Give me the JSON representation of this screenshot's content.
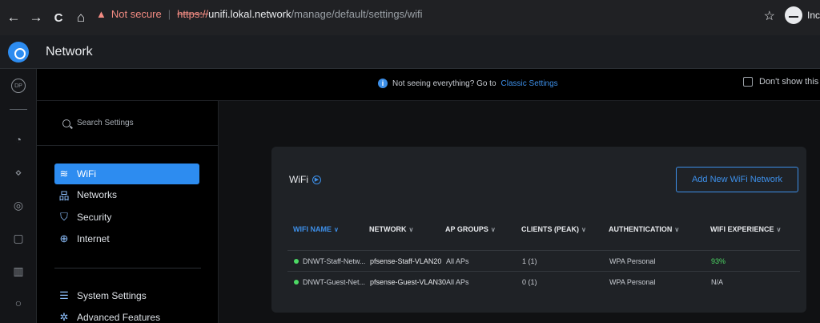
{
  "browser": {
    "back_glyph": "←",
    "forward_glyph": "→",
    "reload_glyph": "C",
    "home_glyph": "⌂",
    "warning_glyph": "▲",
    "not_secure": "Not secure",
    "separator": "|",
    "url_scheme": "https://",
    "url_host": "unifi.lokal.network",
    "url_path": "/manage/default/settings/wifi",
    "star_glyph": "☆",
    "incognito_label": "Incognito"
  },
  "header": {
    "title": "Network"
  },
  "rail": {
    "items": [
      {
        "icon": "dashboard-icon",
        "glyph": "DP"
      },
      {
        "icon": "statistics-icon",
        "glyph": "◔"
      },
      {
        "icon": "topology-icon",
        "glyph": "⋄"
      },
      {
        "icon": "devices-icon",
        "glyph": "◎"
      },
      {
        "icon": "clients-icon",
        "glyph": "▢"
      },
      {
        "icon": "insights-icon",
        "glyph": "▥"
      },
      {
        "icon": "alerts-icon",
        "glyph": "○"
      }
    ]
  },
  "banner": {
    "info_glyph": "i",
    "text": "Not seeing everything? Go to",
    "link": "Classic Settings",
    "dont_show": "Don't show this again"
  },
  "settings_nav": {
    "search_placeholder": "Search Settings",
    "items": [
      {
        "label": "WiFi",
        "icon": "wifi-icon",
        "glyph": "≋",
        "active": true
      },
      {
        "label": "Networks",
        "icon": "networks-icon",
        "glyph": "品",
        "active": false
      },
      {
        "label": "Security",
        "icon": "security-icon",
        "glyph": "⛉",
        "active": false
      },
      {
        "label": "Internet",
        "icon": "internet-icon",
        "glyph": "⊕",
        "active": false
      },
      {
        "label": "System Settings",
        "icon": "system-settings-icon",
        "glyph": "☰",
        "active": false
      },
      {
        "label": "Advanced Features",
        "icon": "advanced-features-icon",
        "glyph": "✲",
        "active": false
      }
    ]
  },
  "wifi": {
    "title": "WiFi",
    "play_glyph": "▶",
    "add_button": "Add New WiFi Network",
    "columns": [
      "WIFI NAME",
      "NETWORK",
      "AP GROUPS",
      "CLIENTS (PEAK)",
      "AUTHENTICATION",
      "WIFI EXPERIENCE"
    ],
    "rows": [
      {
        "name": "DNWT-Staff-Netw...",
        "network": "pfsense-Staff-VLAN20",
        "ap_groups": "All APs",
        "clients": "1 (1)",
        "auth": "WPA Personal",
        "experience": "93%",
        "status_color": "#4cd964"
      },
      {
        "name": "DNWT-Guest-Net...",
        "network": "pfsense-Guest-VLAN30",
        "ap_groups": "All APs",
        "clients": "0 (1)",
        "auth": "WPA Personal",
        "experience": "N/A",
        "status_color": "#4cd964"
      }
    ]
  },
  "colors": {
    "accent": "#2d8cf0",
    "success": "#4cd964",
    "warning": "#f28b82"
  }
}
